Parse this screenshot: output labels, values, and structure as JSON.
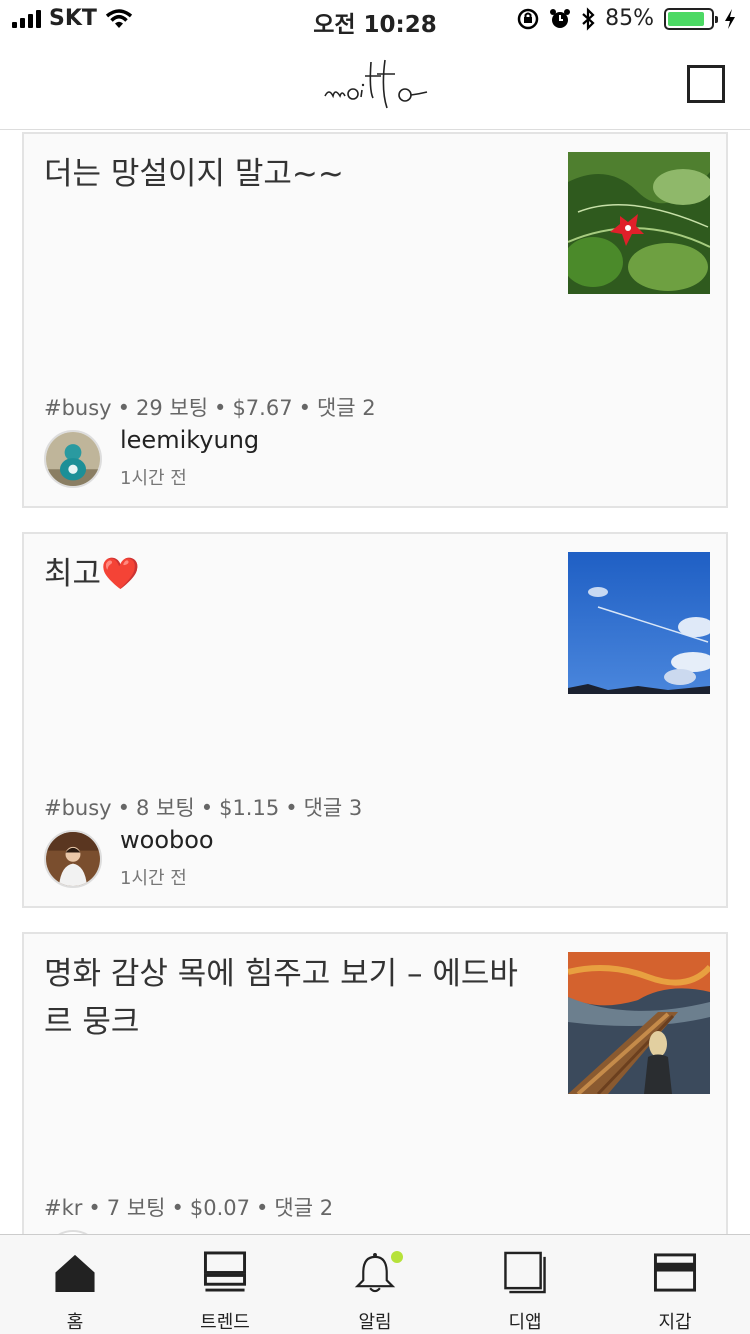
{
  "status_bar": {
    "carrier": "SKT",
    "time": "오전 10:28",
    "battery": "85%",
    "battery_level": 0.85
  },
  "header": {
    "logo_text": "moitto",
    "action_icon": "square-icon"
  },
  "posts": [
    {
      "title": "더는 망설이지 말고~~",
      "tag": "#busy",
      "votes": "29 보팅",
      "amount": "$7.67",
      "comments": "댓글 2",
      "author": "leemikyung",
      "time": "1시간 전",
      "thumb_icon": "red-flower-image",
      "avatar_icon": "teal-figure-avatar"
    },
    {
      "title": "최고❤️",
      "tag": "#busy",
      "votes": "8 보팅",
      "amount": "$1.15",
      "comments": "댓글 3",
      "author": "wooboo",
      "time": "1시간 전",
      "thumb_icon": "blue-sky-image",
      "avatar_icon": "person-avatar"
    },
    {
      "title": "명화 감상 목에 힘주고 보기 – 에드바르 뭉크",
      "tag": "#kr",
      "votes": "7 보팅",
      "amount": "$0.07",
      "comments": "댓글 2",
      "thumb_icon": "the-scream-painting-image"
    }
  ],
  "tabs": [
    {
      "label": "홈",
      "icon": "home-icon"
    },
    {
      "label": "트렌드",
      "icon": "trend-icon"
    },
    {
      "label": "알림",
      "icon": "bell-icon"
    },
    {
      "label": "디앱",
      "icon": "dapp-icon"
    },
    {
      "label": "지갑",
      "icon": "wallet-icon"
    }
  ],
  "colors": {
    "battery_green": "#4cd964",
    "notification_dot": "#b6e23a"
  }
}
